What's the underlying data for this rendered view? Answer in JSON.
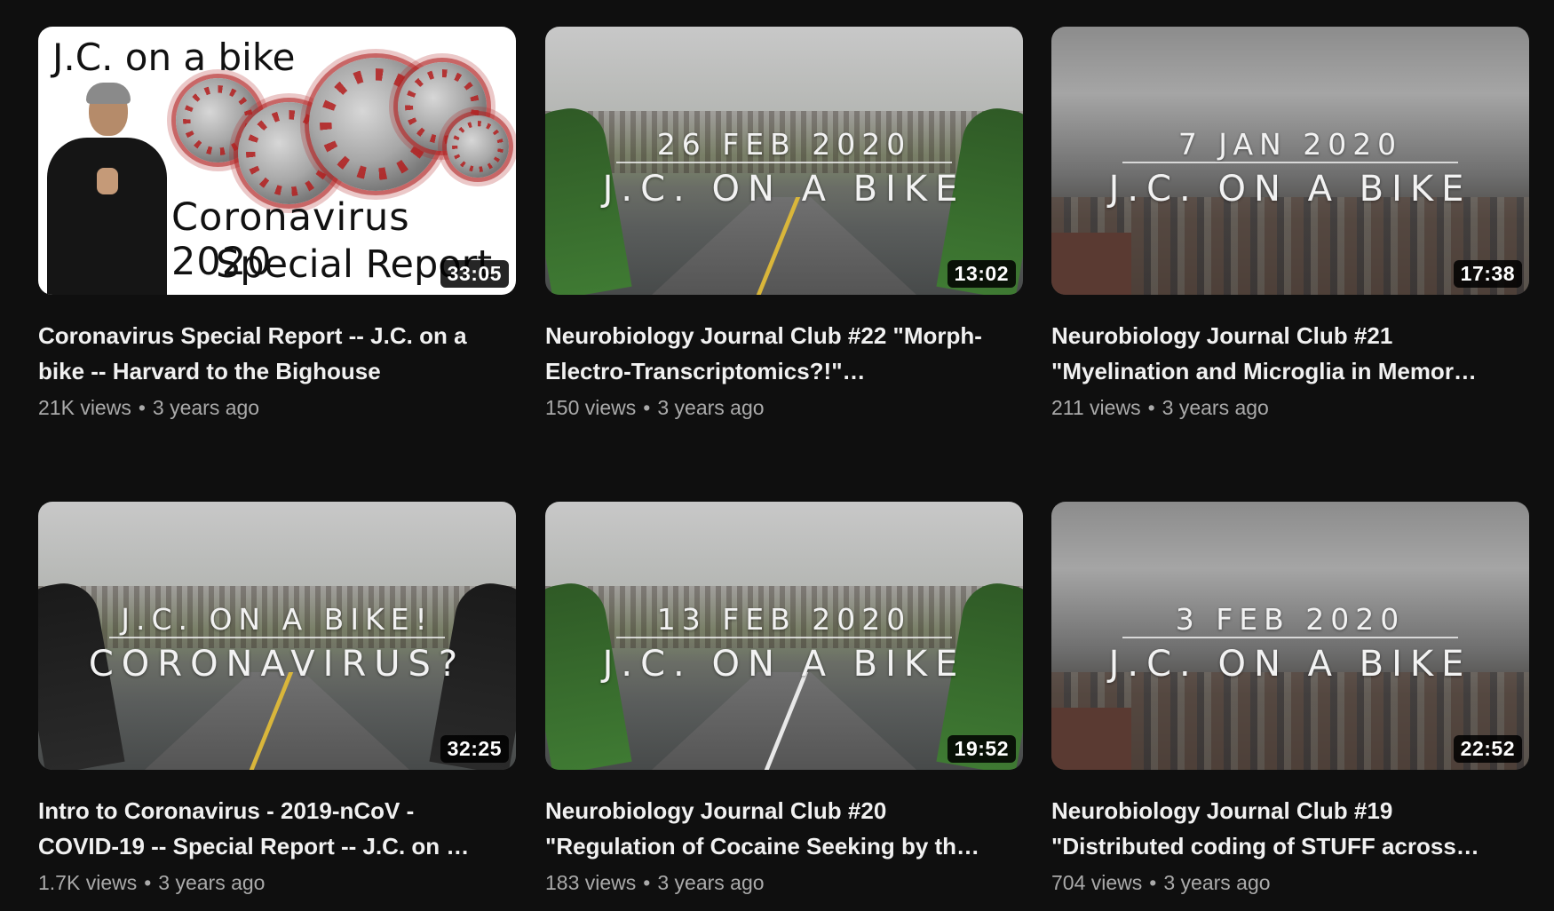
{
  "videos": [
    {
      "title": "Coronavirus Special Report -- J.C. on a bike -- Harvard to the Bighouse",
      "views": "21K views",
      "age": "3 years ago",
      "duration": "33:05",
      "thumb": {
        "type": "special",
        "heading": "J.C. on a bike",
        "line1": "Coronavirus 2020",
        "line2": "Special Report"
      }
    },
    {
      "title": "Neurobiology Journal Club #22 \"Morph-Electro-Transcriptomics?!\"…",
      "views": "150 views",
      "age": "3 years ago",
      "duration": "13:02",
      "thumb": {
        "type": "road",
        "top": "26 FEB 2020",
        "bottom": "J.C. ON A BIKE"
      }
    },
    {
      "title": "Neurobiology Journal Club #21 \"Myelination and Microglia in Memor…",
      "views": "211 views",
      "age": "3 years ago",
      "duration": "17:38",
      "thumb": {
        "type": "city",
        "top": "7 JAN 2020",
        "bottom": "J.C. ON A BIKE"
      }
    },
    {
      "title": "Intro to Coronavirus - 2019-nCoV - COVID-19 -- Special Report -- J.C. on …",
      "views": "1.7K views",
      "age": "3 years ago",
      "duration": "32:25",
      "thumb": {
        "type": "road-dark",
        "top": "J.C. ON A BIKE!",
        "bottom": "CORONAVIRUS?"
      }
    },
    {
      "title": "Neurobiology Journal Club #20 \"Regulation of Cocaine Seeking by th…",
      "views": "183 views",
      "age": "3 years ago",
      "duration": "19:52",
      "thumb": {
        "type": "road",
        "top": "13 FEB 2020",
        "bottom": "J.C. ON A BIKE"
      }
    },
    {
      "title": "Neurobiology Journal Club #19 \"Distributed coding of STUFF across…",
      "views": "704 views",
      "age": "3 years ago",
      "duration": "22:52",
      "thumb": {
        "type": "city",
        "top": "3 FEB 2020",
        "bottom": "J.C. ON A BIKE"
      }
    }
  ],
  "separator": "•"
}
